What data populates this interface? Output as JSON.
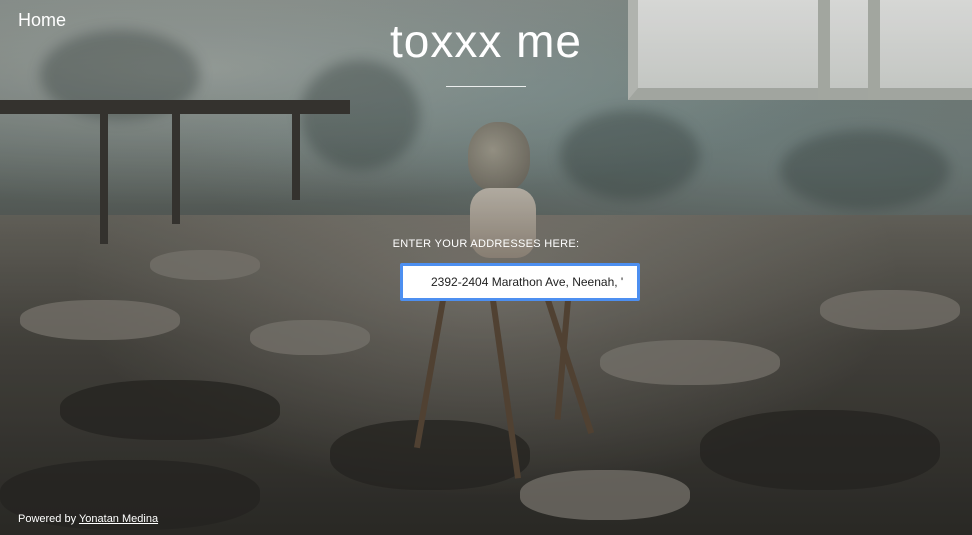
{
  "nav": {
    "home_label": "Home"
  },
  "header": {
    "title": "toxxx me"
  },
  "form": {
    "prompt": "ENTER YOUR ADDRESSES HERE:",
    "address_value": "2392-2404 Marathon Ave, Neenah, '"
  },
  "footer": {
    "powered_by_text": "Powered by",
    "author_link": "Yonatan Medina"
  },
  "colors": {
    "text": "#ffffff",
    "input_focus_border": "#4d8ff0"
  },
  "background": {
    "icon": "abandoned-room-photo"
  }
}
